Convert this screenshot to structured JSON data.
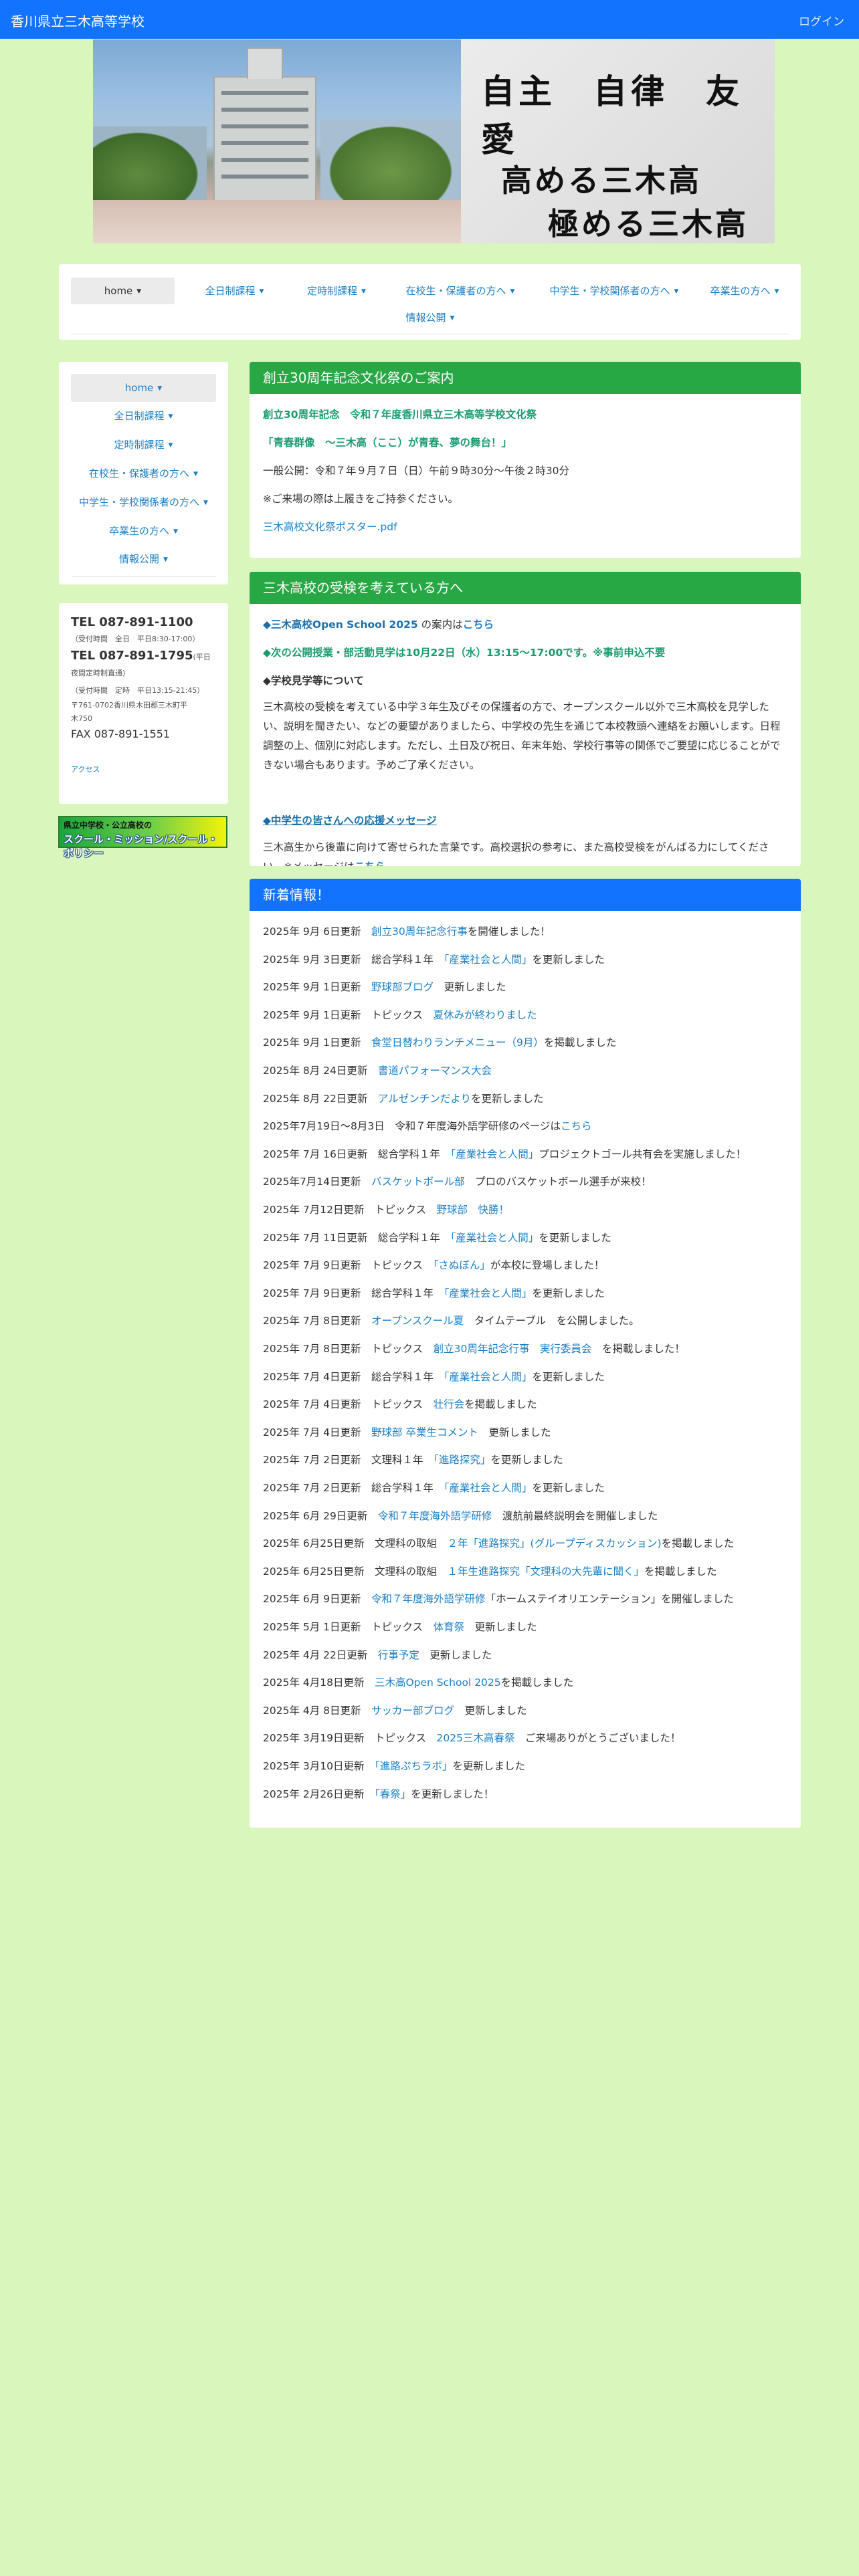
{
  "header": {
    "site_title": "香川県立三木高等学校",
    "login": "ログイン"
  },
  "hero": {
    "motto": "自主　自律　友愛",
    "slogan_line1": "高める三木高",
    "slogan_line2": "極める三木高"
  },
  "topnav": {
    "items": [
      {
        "label": "home"
      },
      {
        "label": "全日制課程"
      },
      {
        "label": "定時制課程"
      },
      {
        "label": "在校生・保護者の方へ"
      },
      {
        "label": "中学生・学校関係者の方へ"
      },
      {
        "label": "卒業生の方へ"
      },
      {
        "label": "情報公開"
      }
    ]
  },
  "sidenav": {
    "items": [
      {
        "label": "home"
      },
      {
        "label": "全日制課程"
      },
      {
        "label": "定時制課程"
      },
      {
        "label": "在校生・保護者の方へ"
      },
      {
        "label": "中学生・学校関係者の方へ"
      },
      {
        "label": "卒業生の方へ"
      },
      {
        "label": "情報公開"
      }
    ]
  },
  "contact": {
    "tel1": "TEL 087-891-1100",
    "tel1_note": "（受付時間　全日　平日8:30-17:00）",
    "tel2": "TEL 087-891-1795",
    "tel2_note_a": "(平日",
    "tel2_note_b": "夜間定時制直通)",
    "tel2_note_c": "（受付時間　定時　平日13:15-21:45）",
    "address1": "〒761-0702香川県木田郡三木町平",
    "address2": "木750",
    "fax": "FAX 087-891-1551",
    "access": "アクセス"
  },
  "banner": {
    "line1": "県立中学校・公立高校の",
    "line2": "スクール・ミッション/スクール・ポリシー"
  },
  "festival": {
    "title": "創立30周年記念文化祭のご案内",
    "line1": "創立30周年記念　令和７年度香川県立三木高等学校文化祭",
    "line2": "「青春群像　〜三木高（ここ）が青春、夢の舞台！」",
    "line3": "一般公開：令和７年９月７日（日）午前９時30分〜午後２時30分",
    "line4": "※ご来場の際は上履きをご持参ください。",
    "link": "三木高校文化祭ポスター.pdf"
  },
  "exam": {
    "title": "三木高校の受検を考えている方へ",
    "oc_a": "◆三木高校Open School 2025",
    "oc_b": " の案内は",
    "oc_link": "こちら",
    "open_class": "◆次の公開授業・部活動見学は10月22日（水）13:15〜17:00です。※事前申込不要",
    "visit_head": "◆学校見学等について",
    "visit_body": "三木高校の受検を考えている中学３年生及びその保護者の方で、オープンスクール以外で三木高校を見学したい、説明を聞きたい、などの要望がありましたら、中学校の先生を通じて本校教頭へ連絡をお願いします。日程調整の上、個別に対応します。ただし、土日及び祝日、年末年始、学校行事等の関係でご要望に応じることができない場合もあります。予めご了承ください。",
    "cheer_link": "◆中学生の皆さんへの応援メッセージ",
    "cheer_body_a": "三木高生から後輩に向けて寄せられた言葉です。高校選択の参考に、また高校受検をがんばる力にしてください。※メッセージは",
    "cheer_body_link": "こちら"
  },
  "news": {
    "title": "新着情報！",
    "items": [
      {
        "date": "2025年 9月  6日更新",
        "pre": "",
        "link": "創立30周年記念行事",
        "post": "を開催しました！"
      },
      {
        "date": "2025年 9月  3日更新",
        "pre": "総合学科１年",
        "link": "「産業社会と人間」",
        "post": "を更新しました"
      },
      {
        "date": "2025年 9月 1日更新",
        "pre": "",
        "link": "野球部ブログ",
        "post": "　更新しました"
      },
      {
        "date": "2025年 9月 1日更新",
        "pre": "トピックス",
        "link": "夏休みが終わりました",
        "post": ""
      },
      {
        "date": "2025年 9月 1日更新",
        "pre": "",
        "link": "食堂日替わりランチメニュー（9月）",
        "post": "を掲載しました"
      },
      {
        "date": "2025年 8月 24日更新",
        "pre": "",
        "link": "書道パフォーマンス大会",
        "post": ""
      },
      {
        "date": "2025年 8月 22日更新",
        "pre": "",
        "link": "アルゼンチンだより",
        "post": "を更新しました"
      },
      {
        "date": "2025年7月19日〜8月3日",
        "pre": "令和７年度海外語学研修のページは",
        "link": "こちら",
        "post": "",
        "nogap": true
      },
      {
        "date": "2025年 7月 16日更新",
        "pre": "総合学科１年",
        "link": "「産業社会と人間」",
        "post": "プロジェクトゴール共有会を実施しました！"
      },
      {
        "date": "2025年7月14日更新",
        "pre": "",
        "link": "バスケットボール部",
        "post": "　プロのバスケットボール選手が来校！"
      },
      {
        "date": "2025年 7月12日更新",
        "pre": "トピックス",
        "link": "野球部　快勝！",
        "post": ""
      },
      {
        "date": "2025年 7月 11日更新",
        "pre": "総合学科１年",
        "link": "「産業社会と人間」",
        "post": "を更新しました"
      },
      {
        "date": "2025年 7月 9日更新",
        "pre": "トピックス",
        "link": "「さぬぼん」",
        "post": "が本校に登場しました！"
      },
      {
        "date": "2025年 7月  9日更新",
        "pre": "総合学科１年",
        "link": "「産業社会と人間」",
        "post": "を更新しました"
      },
      {
        "date": "2025年 7月 8日更新",
        "pre": "",
        "link": "オープンスクール夏",
        "post": "　タイムテーブル　を公開しました。"
      },
      {
        "date": "2025年 7月 8日更新",
        "pre": "トピックス",
        "link": "創立30周年記念行事　実行委員会",
        "post": "　を掲載しました！"
      },
      {
        "date": "2025年 7月  4日更新",
        "pre": "総合学科１年",
        "link": "「産業社会と人間」",
        "post": "を更新しました"
      },
      {
        "date": "2025年 7月 4日更新",
        "pre": "トピックス",
        "link": "壮行会",
        "post": "を掲載しました"
      },
      {
        "date": "2025年 7月  4日更新",
        "pre": "",
        "link": "野球部 卒業生コメント",
        "post": "　更新しました"
      },
      {
        "date": "2025年 7月  2日更新",
        "pre": "文理科１年",
        "link": "「進路探究」",
        "post": "を更新しました"
      },
      {
        "date": "2025年 7月  2日更新",
        "pre": "総合学科１年",
        "link": "「産業社会と人間」",
        "post": "を更新しました"
      },
      {
        "date": "2025年 6月 29日更新",
        "pre": "",
        "link": "令和７年度海外語学研修",
        "post": "　渡航前最終説明会を開催しました"
      },
      {
        "date": "2025年 6月25日更新",
        "pre": "文理科の取組",
        "link": "２年「進路探究」(グループディスカッション)",
        "post": "を掲載しました"
      },
      {
        "date": "2025年 6月25日更新",
        "pre": "文理科の取組",
        "link": "１年生進路探究「文理科の大先輩に聞く」",
        "post": "を掲載しました"
      },
      {
        "date": "2025年 6月 9日更新",
        "pre": "",
        "link": "令和７年度海外語学研修",
        "post": "「ホームステイオリエンテーション」を開催しました"
      },
      {
        "date": "2025年 5月 1日更新",
        "pre": "トピックス",
        "link": "体育祭",
        "post": "　更新しました"
      },
      {
        "date": "2025年 4月 22日更新",
        "pre": "",
        "link": "行事予定",
        "post": "　更新しました"
      },
      {
        "date": "2025年 4月18日更新",
        "pre": "",
        "link": "三木高Open School 2025",
        "post": "を掲載しました"
      },
      {
        "date": "2025年 4月 8日更新",
        "pre": "",
        "link": "サッカー部ブログ",
        "post": "　更新しました"
      },
      {
        "date": "2025年 3月19日更新",
        "pre": "トピックス",
        "link": "2025三木高春祭",
        "post": "　ご来場ありがとうございました！"
      },
      {
        "date": "2025年 3月10日更新",
        "pre": "",
        "link": "「進路ぷちラボ」",
        "post": "を更新しました"
      },
      {
        "date": "2025年 2月26日更新",
        "pre": "",
        "link": "「春祭」",
        "post": "を更新しました！"
      }
    ]
  },
  "colors": {
    "page_bg": "#d9f7bd",
    "header_blue": "#1173ff",
    "panel_green": "#28a745",
    "link_blue": "#1b7fc4"
  }
}
